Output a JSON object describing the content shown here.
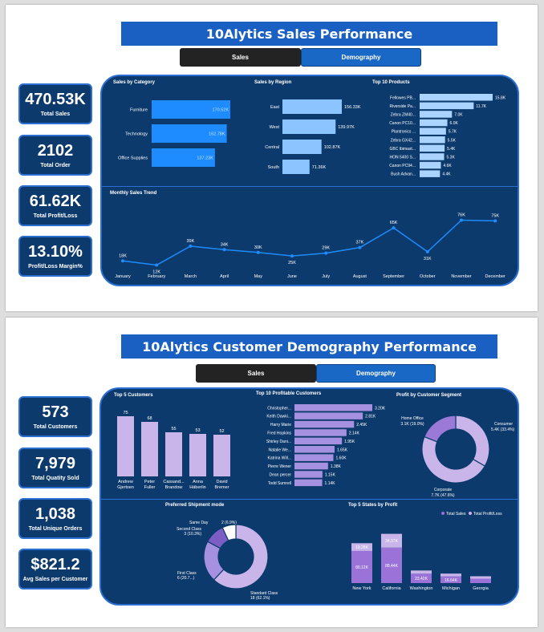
{
  "page1": {
    "title": "10Alytics Sales Performance",
    "tabs": [
      {
        "label": "Sales"
      },
      {
        "label": "Demography"
      }
    ],
    "kpis": [
      {
        "value": "470.53K",
        "label": "Total Sales"
      },
      {
        "value": "2102",
        "label": "Total Order"
      },
      {
        "value": "61.62K",
        "label": "Total Profit/Loss"
      },
      {
        "value": "13.10%",
        "label": "Profit/Loss Margin%"
      }
    ]
  },
  "page2": {
    "title": "10Alytics Customer Demography Performance",
    "tabs": [
      {
        "label": "Sales"
      },
      {
        "label": "Demography"
      }
    ],
    "kpis": [
      {
        "value": "573",
        "label": "Total Customers"
      },
      {
        "value": "7,979",
        "label": "Total Quatity Sold"
      },
      {
        "value": "1,038",
        "label": "Total Unique Orders"
      },
      {
        "value": "$821.2",
        "label": "Avg Sales per Customer"
      }
    ]
  },
  "colors": {
    "panel": "#0d3a6c",
    "border": "#2c6fd2",
    "title_bar": "#1a5fc2",
    "bar_blue": "#1e8cff",
    "bar_light": "#8cc4ff",
    "bar_pale": "#aad4ff",
    "line": "#1e8cff",
    "bar_lavender": "#c9b5ea",
    "bar_purple": "#a690e0",
    "donut_dark": "#9a7ad6",
    "donut_light": "#c9b5ea",
    "total_sales": "#9a72d8",
    "profit": "#c9b5ea"
  },
  "chart_data": [
    {
      "type": "bar",
      "orientation": "horizontal",
      "title": "Sales by Category",
      "categories": [
        "Furniture",
        "Technology",
        "Office Supplies"
      ],
      "values": [
        170.52,
        162.78,
        137.23
      ],
      "labels": [
        "170.52K",
        "162.78K",
        "137.23K"
      ]
    },
    {
      "type": "bar",
      "orientation": "horizontal",
      "title": "Sales by Region",
      "categories": [
        "East",
        "West",
        "Central",
        "South"
      ],
      "values": [
        156.33,
        139.97,
        102.87,
        71.36
      ],
      "labels": [
        "156.33K",
        "139.97K",
        "102.87K",
        "71.36K"
      ]
    },
    {
      "type": "bar",
      "orientation": "horizontal",
      "title": "Top 10 Products",
      "categories": [
        "Fellowes PB...",
        "Riverside Pa...",
        "Zebra ZM40...",
        "Canon PC10...",
        "Plantronics ...",
        "Zebra GX42...",
        "GBC Ibimast...",
        "HON 5400 S...",
        "Canon PC94...",
        "Bush Advan..."
      ],
      "values": [
        15.8,
        11.7,
        7.0,
        6.0,
        5.7,
        5.5,
        5.4,
        5.3,
        4.6,
        4.4
      ],
      "labels": [
        "15.8K",
        "11.7K",
        "7.0K",
        "6.0K",
        "5.7K",
        "5.5K",
        "5.4K",
        "5.3K",
        "4.6K",
        "4.4K"
      ]
    },
    {
      "type": "line",
      "title": "Monthly Sales Trend",
      "x": [
        "January",
        "February",
        "March",
        "April",
        "May",
        "June",
        "July",
        "August",
        "September",
        "October",
        "November",
        "December"
      ],
      "values": [
        18,
        12,
        39,
        34,
        30,
        25,
        29,
        37,
        65,
        31,
        76,
        75
      ],
      "labels": [
        "18K",
        "12K",
        "39K",
        "34K",
        "30K",
        "25K",
        "29K",
        "37K",
        "65K",
        "31K",
        "76K",
        "75K"
      ],
      "ylim": [
        0,
        80
      ]
    },
    {
      "type": "bar",
      "orientation": "vertical",
      "title": "Top 5 Customers",
      "categories": [
        "Andrew Gjertsen",
        "Peter Fuller",
        "Cassand... Brandow",
        "Anna Häberlin",
        "David Bremer"
      ],
      "category_lines": [
        [
          "Andrew",
          "Gjertsen"
        ],
        [
          "Peter",
          "Fuller"
        ],
        [
          "Cassand...",
          "Brandow"
        ],
        [
          "Anna",
          "Häberlin"
        ],
        [
          "David",
          "Bremer"
        ]
      ],
      "values": [
        75,
        68,
        55,
        53,
        52
      ],
      "labels": [
        "75",
        "68",
        "55",
        "53",
        "52"
      ]
    },
    {
      "type": "bar",
      "orientation": "horizontal",
      "title": "Top 10 Profitable Customers",
      "categories": [
        "Christopher...",
        "Keith Dawki...",
        "Harry Marie",
        "Fred Hopkins",
        "Shirley Dani...",
        "Natalie We...",
        "Katrina Will...",
        "Pierre Wener",
        "Dean percer",
        "Todd Sumrell"
      ],
      "values": [
        3.2,
        2.81,
        2.45,
        2.14,
        1.95,
        1.65,
        1.6,
        1.38,
        1.15,
        1.14
      ],
      "labels": [
        "3.20K",
        "2.81K",
        "2.45K",
        "2.14K",
        "1.95K",
        "1.65K",
        "1.60K",
        "1.38K",
        "1.15K",
        "1.14K"
      ]
    },
    {
      "type": "pie",
      "donut": true,
      "title": "Profit by Customer Segment",
      "categories": [
        "Consumer",
        "Corporate",
        "Home Office"
      ],
      "values": [
        33.4,
        47.6,
        19.0
      ],
      "labels": [
        "5.4K (33.4%)",
        "7.7K (47.6%)",
        "3.1K (19.0%)"
      ]
    },
    {
      "type": "pie",
      "donut": true,
      "title": "Preferred Shipment mode",
      "categories": [
        "Standard Class",
        "First Class",
        "Second Class",
        "Same Day"
      ],
      "values": [
        62.1,
        20.7,
        10.3,
        6.9
      ],
      "labels": [
        "18 (62.1%)",
        "6 (20.7...)",
        "3 (10.3%)",
        "2 (6.9%)"
      ]
    },
    {
      "type": "bar",
      "orientation": "vertical",
      "stacked": true,
      "title": "Top 5 States by Profit",
      "categories": [
        "New York",
        "California",
        "Washington",
        "Michigan",
        "Georgia"
      ],
      "series": [
        {
          "name": "Total Sales",
          "values": [
            80.12,
            88.44,
            23.42,
            16.64,
            11.0
          ],
          "labels": [
            "80.12K",
            "88.44K",
            "23.42K",
            "16.64K",
            ""
          ]
        },
        {
          "name": "Total Profit/Loss",
          "values": [
            19.28,
            34.37,
            8.0,
            7.0,
            6.0
          ],
          "labels": [
            "19.28K",
            "34.37K",
            "",
            "",
            ""
          ]
        }
      ]
    }
  ]
}
